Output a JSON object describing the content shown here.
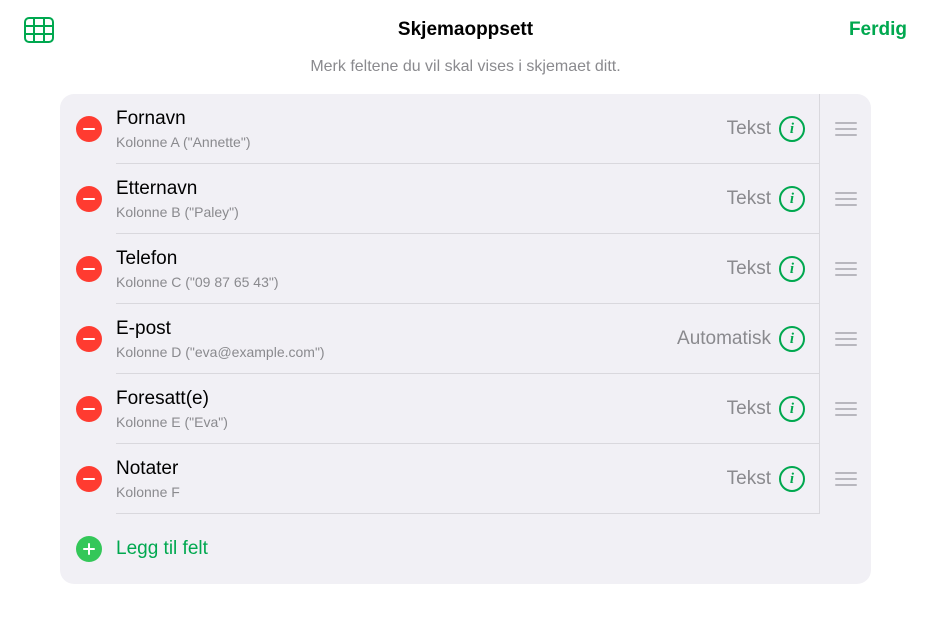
{
  "header": {
    "title": "Skjemaoppsett",
    "done": "Ferdig"
  },
  "subtitle": "Merk feltene du vil skal vises i skjemaet ditt.",
  "fields": [
    {
      "title": "Fornavn",
      "caption": "Kolonne A (\"Annette\")",
      "type": "Tekst"
    },
    {
      "title": "Etternavn",
      "caption": "Kolonne B (\"Paley\")",
      "type": "Tekst"
    },
    {
      "title": "Telefon",
      "caption": "Kolonne C (\"09 87 65 43\")",
      "type": "Tekst"
    },
    {
      "title": "E-post",
      "caption": "Kolonne D (\"eva@example.com\")",
      "type": "Automatisk"
    },
    {
      "title": "Foresatt(e)",
      "caption": "Kolonne E (\"Eva\")",
      "type": "Tekst"
    },
    {
      "title": "Notater",
      "caption": "Kolonne F",
      "type": "Tekst"
    }
  ],
  "addField": "Legg til felt"
}
